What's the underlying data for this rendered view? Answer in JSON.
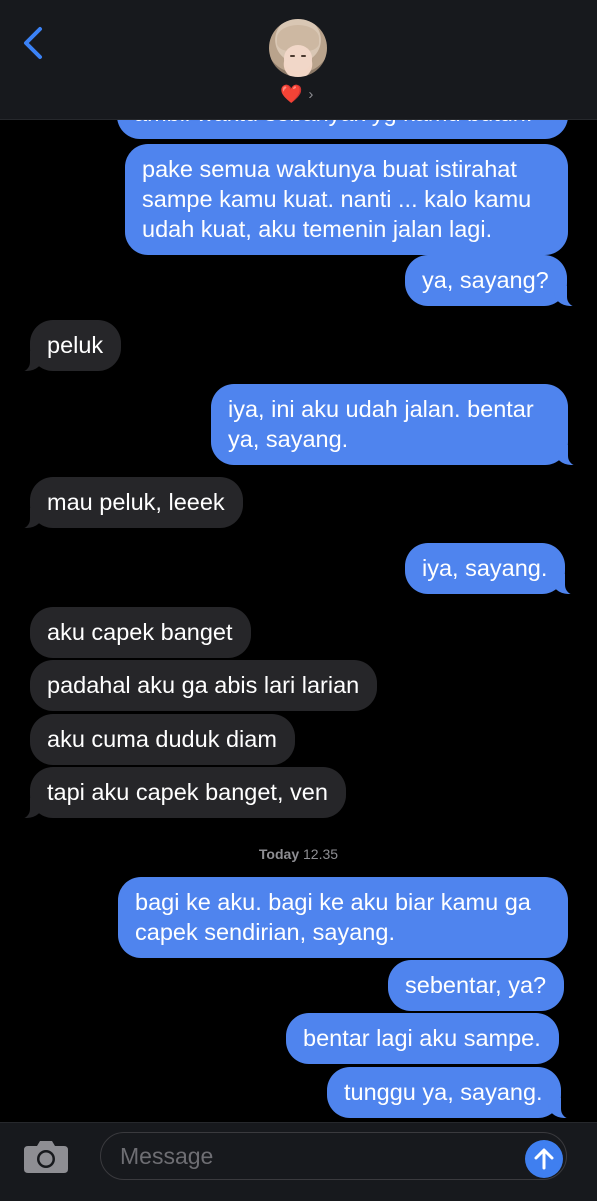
{
  "header": {
    "back_icon": "chevron-left-icon",
    "contact_name": "❤️",
    "disclosure_icon": "chevron-right-icon"
  },
  "messages": [
    {
      "dir": "out",
      "text": "ambil waktu sebanyak yg kamu butuh.",
      "tail": false
    },
    {
      "dir": "out",
      "text": "pake semua waktunya buat istirahat\nsampe kamu kuat. nanti ... kalo kamu\nudah kuat, aku temenin jalan lagi.",
      "tail": false
    },
    {
      "dir": "out",
      "text": "ya, sayang?",
      "tail": true
    },
    {
      "dir": "in",
      "text": "peluk",
      "tail": true
    },
    {
      "dir": "out",
      "text": "iya, ini aku udah jalan. bentar\nya, sayang.",
      "tail": true
    },
    {
      "dir": "in",
      "text": "mau peluk, leeek",
      "tail": true
    },
    {
      "dir": "out",
      "text": "iya, sayang.",
      "tail": true
    },
    {
      "dir": "in",
      "text": "aku capek banget",
      "tail": false
    },
    {
      "dir": "in",
      "text": "padahal aku ga abis lari larian",
      "tail": false
    },
    {
      "dir": "in",
      "text": "aku cuma duduk diam",
      "tail": false
    },
    {
      "dir": "in",
      "text": "tapi aku capek banget, ven",
      "tail": true
    },
    {
      "dir": "out",
      "text": "bagi ke aku. bagi ke aku biar kamu ga\ncapek sendirian, sayang.",
      "tail": false
    },
    {
      "dir": "out",
      "text": "sebentar, ya?",
      "tail": false
    },
    {
      "dir": "out",
      "text": "bentar lagi aku sampe.",
      "tail": false
    },
    {
      "dir": "out",
      "text": "tunggu ya, sayang.",
      "tail": true
    }
  ],
  "timestamp": {
    "day": "Today",
    "time": "12.35"
  },
  "composer": {
    "camera_icon": "camera-icon",
    "placeholder": "Message",
    "value": "",
    "send_icon": "arrow-up-icon"
  },
  "colors": {
    "outgoing_bubble": "#4f84ee",
    "incoming_bubble": "#262629",
    "background": "#000000",
    "bar": "#17191d",
    "send_button": "#3f7ff0"
  }
}
